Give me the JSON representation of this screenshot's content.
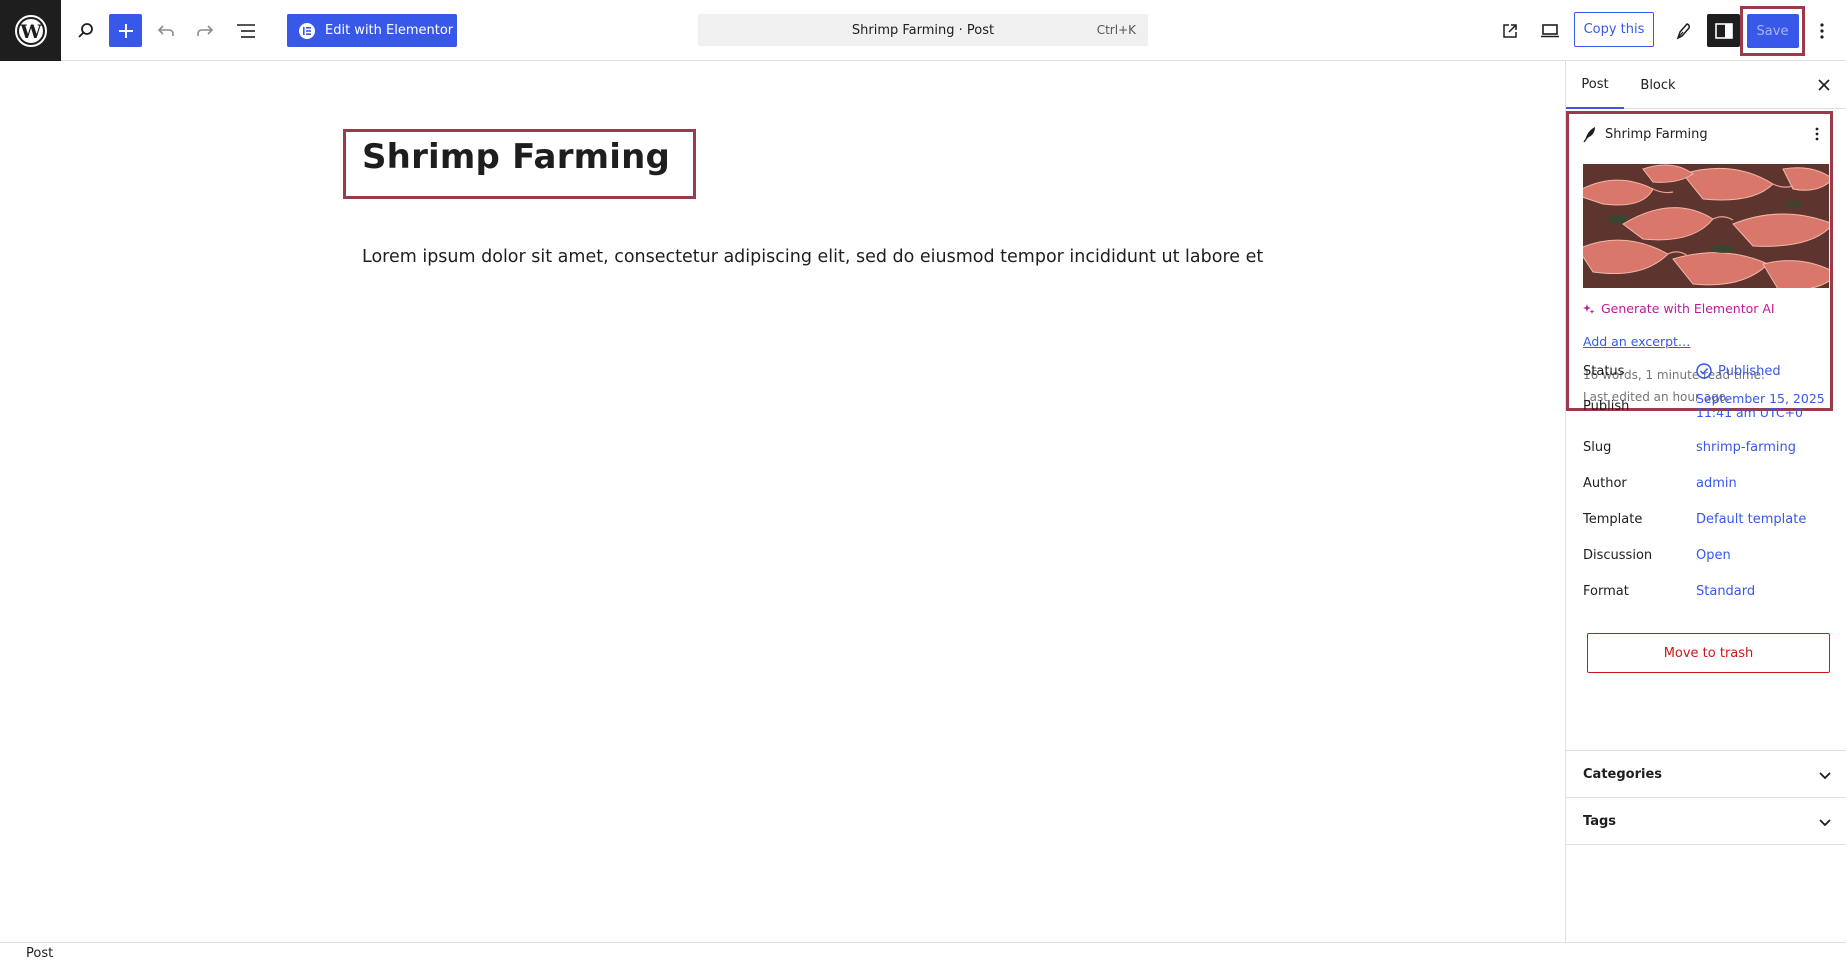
{
  "topbar": {
    "elementor_label": "Edit with Elementor",
    "command_title": "Shrimp Farming · Post",
    "command_shortcut": "Ctrl+K",
    "copy_label": "Copy this",
    "save_label": "Save"
  },
  "editor": {
    "title": "Shrimp Farming",
    "body": "Lorem ipsum dolor sit amet, consectetur adipiscing elit, sed do eiusmod tempor incididunt ut labore et"
  },
  "sidebar": {
    "tabs": [
      {
        "label": "Post",
        "active": true
      },
      {
        "label": "Block",
        "active": false
      }
    ],
    "card": {
      "title": "Shrimp Farming",
      "generate_ai": "Generate with Elementor AI",
      "excerpt_link": "Add an excerpt…",
      "stats": "16 words, 1 minute read time.",
      "last_edited": "Last edited an hour ago."
    },
    "fields": [
      {
        "label": "Status",
        "value": "Published"
      },
      {
        "label": "Publish",
        "value": "September 15, 2025",
        "value2": "11:41 am UTC+0"
      },
      {
        "label": "Slug",
        "value": "shrimp-farming"
      },
      {
        "label": "Author",
        "value": "admin"
      },
      {
        "label": "Template",
        "value": "Default template"
      },
      {
        "label": "Discussion",
        "value": "Open"
      },
      {
        "label": "Format",
        "value": "Standard"
      }
    ],
    "trash_label": "Move to trash",
    "panels": [
      {
        "label": "Categories"
      },
      {
        "label": "Tags"
      }
    ]
  },
  "footer": {
    "breadcrumb": "Post"
  },
  "colors": {
    "accent": "#3858e9",
    "highlight_border": "#9b3a48",
    "danger": "#cc1818",
    "ai": "#c0199b"
  },
  "icons": [
    "wordpress-icon",
    "search-icon",
    "plus-icon",
    "undo-icon",
    "redo-icon",
    "list-view-icon",
    "elementor-icon",
    "external-link-icon",
    "desktop-icon",
    "pen-icon",
    "sidebar-icon",
    "more-vertical-icon",
    "close-icon",
    "feather-icon",
    "ai-sparkle-icon",
    "check-circle-icon",
    "chevron-down-icon"
  ]
}
